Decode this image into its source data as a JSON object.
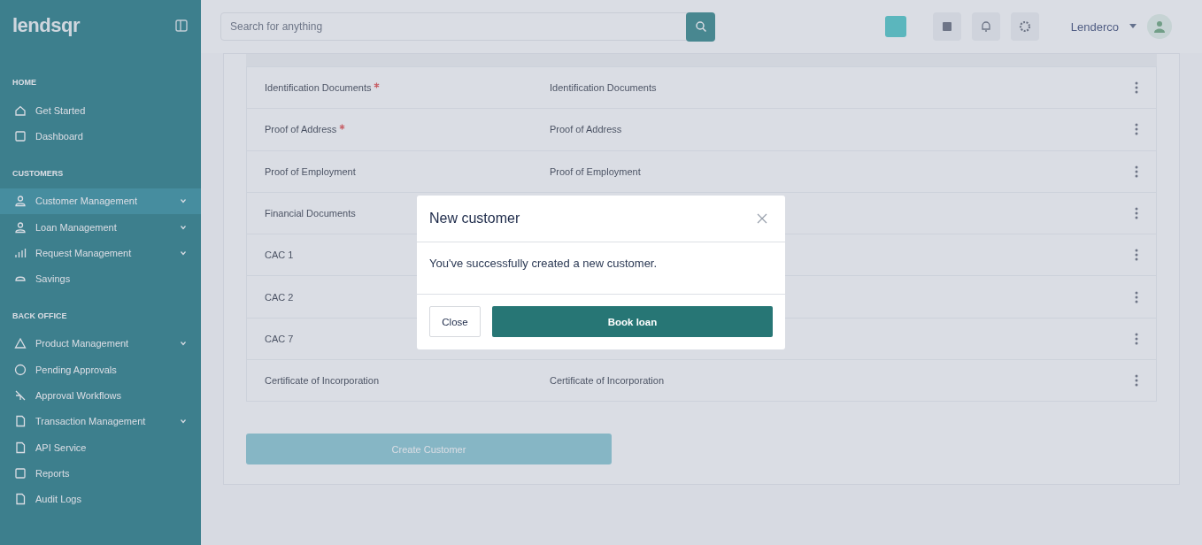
{
  "sidebar": {
    "logo": "lendsqr",
    "sections": [
      {
        "title": "HOME",
        "items": [
          {
            "label": "Get Started",
            "selected": false,
            "expandable": false
          },
          {
            "label": "Dashboard",
            "selected": false,
            "expandable": false
          }
        ]
      },
      {
        "title": "CUSTOMERS",
        "items": [
          {
            "label": "Customer Management",
            "selected": true,
            "expandable": true
          },
          {
            "label": "Loan Management",
            "selected": false,
            "expandable": true
          },
          {
            "label": "Request Management",
            "selected": false,
            "expandable": true
          },
          {
            "label": "Savings",
            "selected": false,
            "expandable": false
          }
        ]
      },
      {
        "title": "BACK OFFICE",
        "items": [
          {
            "label": "Product Management",
            "selected": false,
            "expandable": true
          },
          {
            "label": "Pending Approvals",
            "selected": false,
            "expandable": false
          },
          {
            "label": "Approval Workflows",
            "selected": false,
            "expandable": false
          },
          {
            "label": "Transaction Management",
            "selected": false,
            "expandable": true
          },
          {
            "label": "API Service",
            "selected": false,
            "expandable": false
          },
          {
            "label": "Reports",
            "selected": false,
            "expandable": false
          },
          {
            "label": "Audit Logs",
            "selected": false,
            "expandable": false
          }
        ]
      }
    ]
  },
  "topbar": {
    "search": {
      "placeholder": "Search for anything"
    },
    "user": "Lenderco"
  },
  "documents": [
    {
      "name": "Identification Documents",
      "required": true,
      "value": "Identification Documents"
    },
    {
      "name": "Proof of Address",
      "required": true,
      "value": "Proof of Address"
    },
    {
      "name": "Proof of Employment",
      "required": false,
      "value": "Proof of Employment"
    },
    {
      "name": "Financial Documents",
      "required": false
    },
    {
      "name": "CAC 1",
      "required": false
    },
    {
      "name": "CAC 2",
      "required": false
    },
    {
      "name": "CAC 7",
      "required": false
    },
    {
      "name": "Certificate of Incorporation",
      "required": false,
      "value": "Certificate of Incorporation"
    }
  ],
  "create_button": {
    "label": "Create Customer",
    "disabled": true
  },
  "modal": {
    "title": "New customer",
    "message": "You've successfully created a new customer.",
    "buttons": [
      {
        "label": "Close",
        "kind": "secondary"
      },
      {
        "label": "Book loan",
        "kind": "primary"
      }
    ]
  }
}
